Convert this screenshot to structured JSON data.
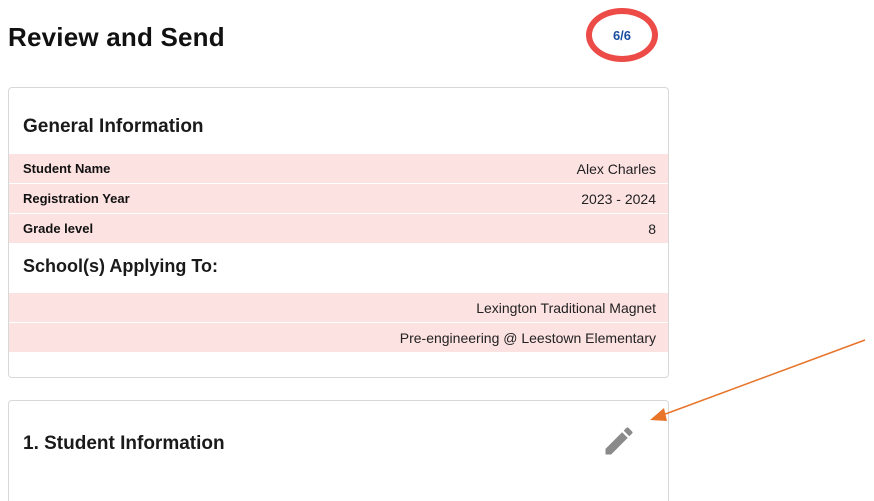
{
  "header": {
    "title": "Review and Send",
    "step_badge": "6/6"
  },
  "general_info": {
    "title": "General Information",
    "rows": [
      {
        "label": "Student Name",
        "value": "Alex Charles"
      },
      {
        "label": "Registration Year",
        "value": "2023 - 2024"
      },
      {
        "label": "Grade level",
        "value": "8"
      }
    ],
    "schools_title": "School(s) Applying To:",
    "schools": [
      "Lexington Traditional Magnet",
      "Pre-engineering @ Leestown Elementary"
    ]
  },
  "student_info": {
    "title": "1. Student Information",
    "edit_icon": "pencil-icon"
  },
  "colors": {
    "badge_ring": "#ec4b47",
    "badge_text": "#1a4fa0",
    "row_highlight": "#fde2e2",
    "annotation_arrow": "#e8742a"
  }
}
